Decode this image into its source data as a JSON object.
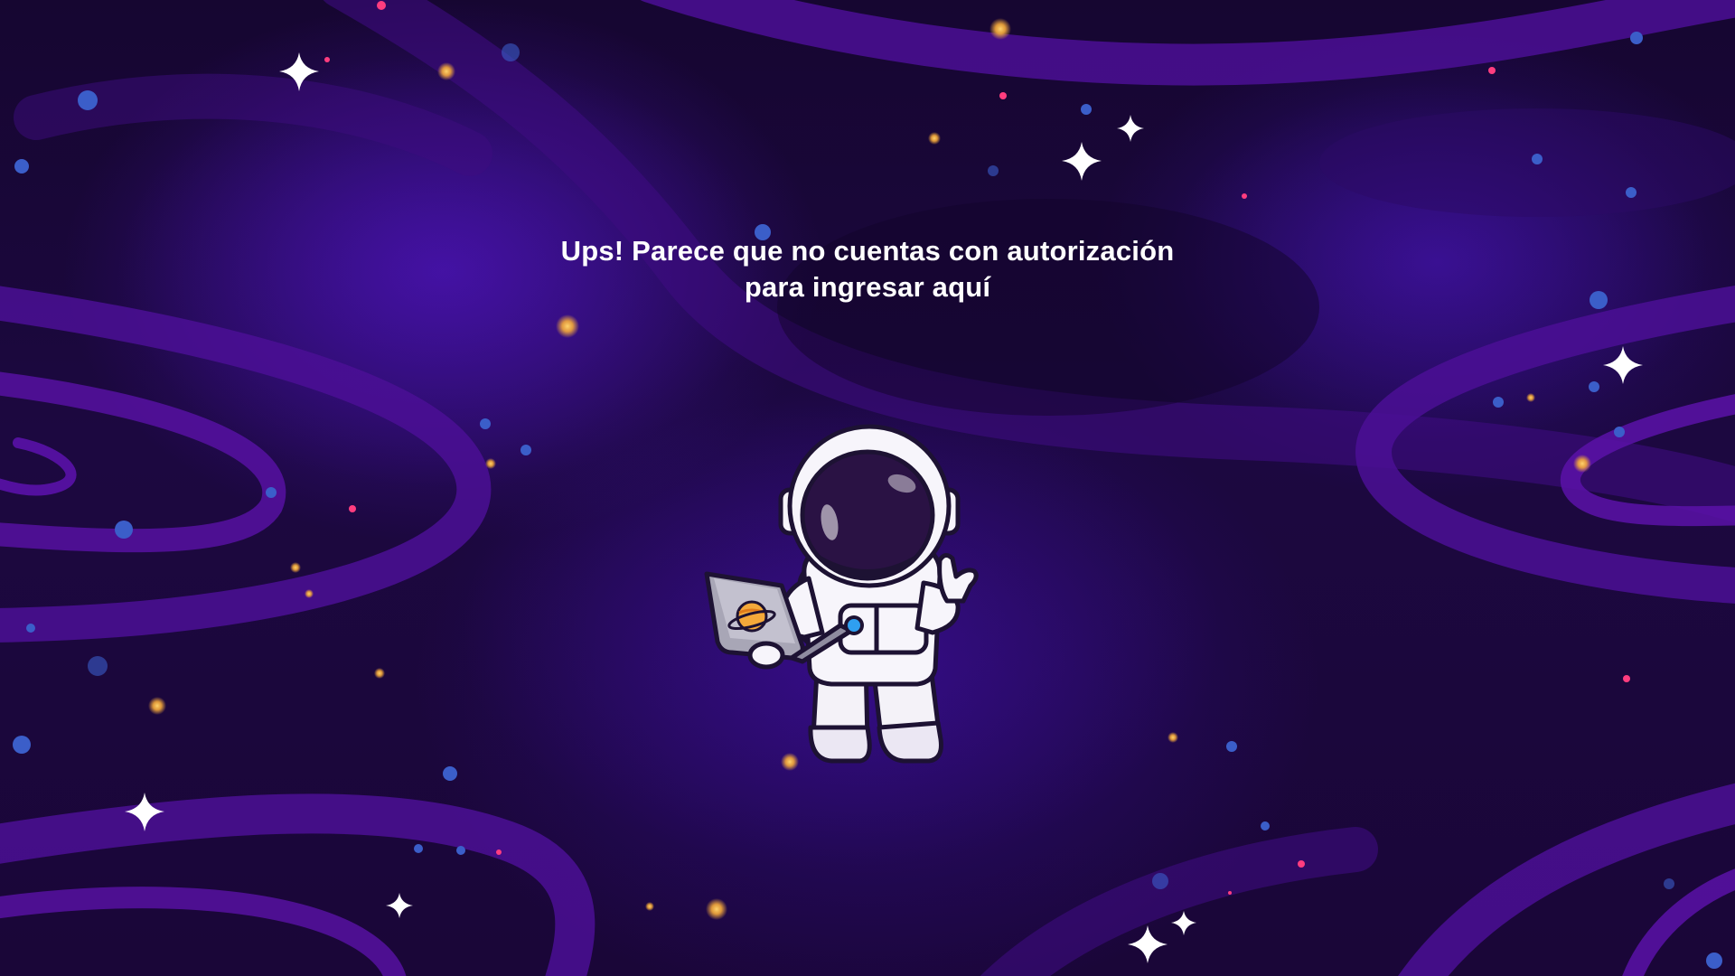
{
  "page": {
    "message_line1": "Ups! Parece que no cuentas con autorización",
    "message_line2": "para ingresar aquí"
  },
  "illustration": {
    "subject": "astronaut-with-laptop",
    "laptop_sticker": "planet-icon"
  },
  "colors": {
    "background_dark": "#150530",
    "nebula_purple": "#5a12a8",
    "swirl_purple": "#4b0f95",
    "text": "#ffffff",
    "star_white": "#ffffff",
    "dot_gold": "#f4a93a",
    "dot_blue": "#3b5ec9",
    "dot_pink": "#ff3d7f"
  }
}
